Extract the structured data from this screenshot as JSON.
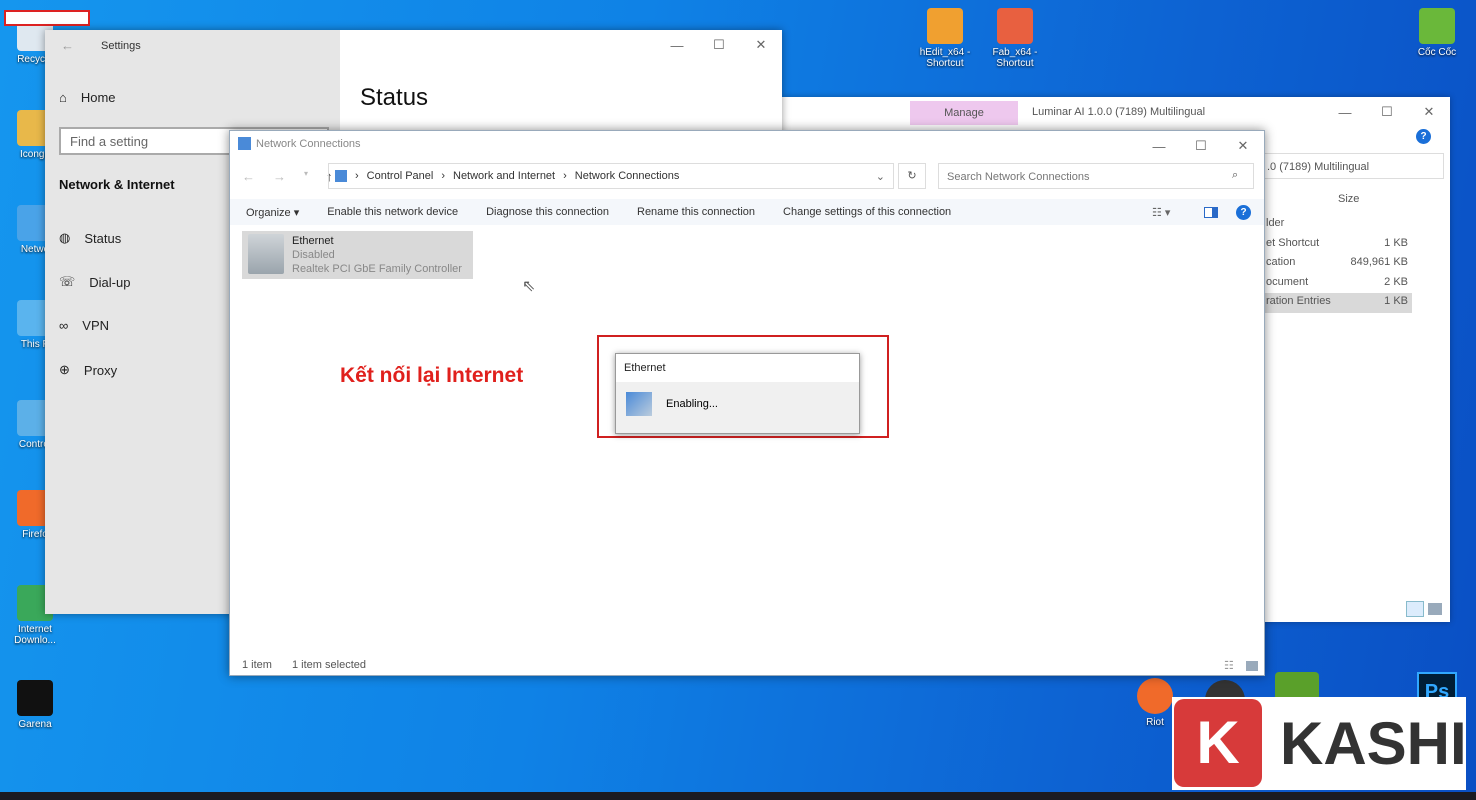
{
  "desktop": {
    "icons_left": [
      {
        "label": "Recycle",
        "color": "#dfe8f0"
      },
      {
        "label": "Icongn",
        "color": "#e8b84a"
      },
      {
        "label": "Netwo",
        "color": "#4aa3e8"
      },
      {
        "label": "This P",
        "color": "#5ab4ee"
      },
      {
        "label": "Control",
        "color": "#5cb0e8"
      },
      {
        "label": "Firefo",
        "color": "#f06a2a"
      },
      {
        "label": "Internet Downlo...",
        "color": "#3aa85a"
      },
      {
        "label": "Garena",
        "color": "#111"
      }
    ],
    "icons_top": [
      {
        "label": "hEdit_x64 - Shortcut",
        "color": "#f0a030"
      },
      {
        "label": "Fab_x64 - Shortcut",
        "color": "#e86040"
      },
      {
        "label": "Cốc Cốc",
        "color": "#6ab83a"
      }
    ],
    "icons_bottom": [
      {
        "label": "Riot",
        "color": "#f06a2a"
      }
    ]
  },
  "settings": {
    "title": "Settings",
    "home": "Home",
    "search_placeholder": "Find a setting",
    "section": "Network & Internet",
    "nav": [
      "Status",
      "Dial-up",
      "VPN",
      "Proxy"
    ],
    "page_title": "Status"
  },
  "explorer_back": {
    "ribbon_tab": "Manage",
    "title": "Luminar AI 1.0.0 (7189) Multilingual",
    "address": ".0 (7189) Multilingual",
    "column_size": "Size",
    "rows": [
      {
        "type": "lder",
        "size": ""
      },
      {
        "type": "et Shortcut",
        "size": "1 KB"
      },
      {
        "type": "cation",
        "size": "849,961 KB"
      },
      {
        "type": "ocument",
        "size": "2 KB"
      },
      {
        "type": "ration Entries",
        "size": "1 KB"
      }
    ]
  },
  "network": {
    "title": "Network Connections",
    "breadcrumb": [
      "Control Panel",
      "Network and Internet",
      "Network Connections"
    ],
    "search_placeholder": "Search Network Connections",
    "commands": [
      "Organize ▾",
      "Enable this network device",
      "Diagnose this connection",
      "Rename this connection",
      "Change settings of this connection"
    ],
    "item": {
      "name": "Ethernet",
      "status": "Disabled",
      "device": "Realtek PCI GbE Family Controller"
    },
    "status_count": "1 item",
    "status_selected": "1 item selected"
  },
  "dialog": {
    "title": "Ethernet",
    "message": "Enabling..."
  },
  "annotation": "Kết nối lại Internet",
  "logo": {
    "letter": "K",
    "text": "KASHI",
    "color": "#d73a3a"
  }
}
